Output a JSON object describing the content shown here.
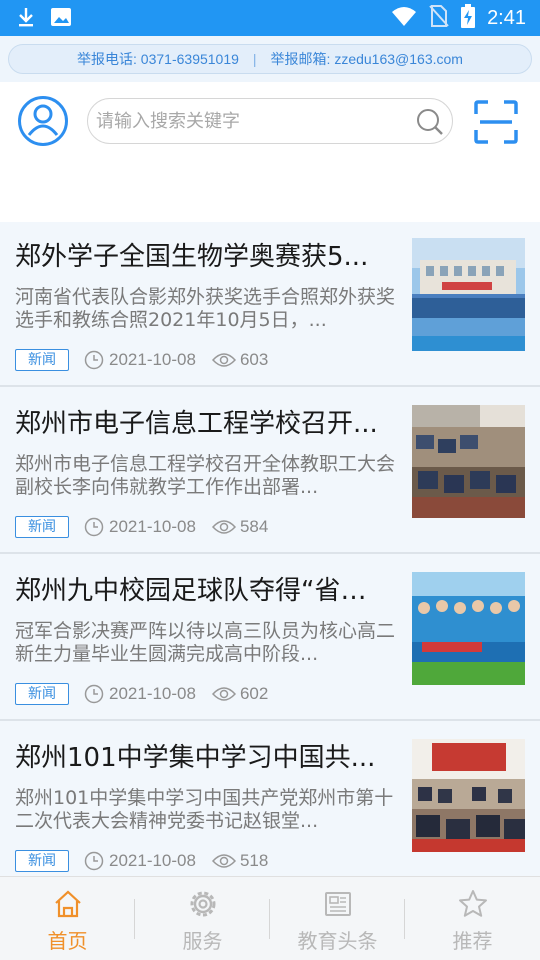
{
  "status_bar": {
    "time": "2:41",
    "icons": [
      "download-icon",
      "image-icon",
      "wifi-icon",
      "no-sim-icon",
      "battery-charging-icon"
    ]
  },
  "report": {
    "phone": "举报电话: 0371-63951019",
    "separator": "|",
    "email": "举报邮箱: zzedu163@163.com"
  },
  "header": {
    "search_placeholder": "请输入搜索关键字"
  },
  "news": [
    {
      "title": "郑外学子全国生物学奥赛获5...",
      "summary": "河南省代表队合影郑外获奖选手合照郑外获奖选手和教练合照2021年10月5日，...",
      "tag": "新闻",
      "date": "2021-10-08",
      "views": "603"
    },
    {
      "title": "郑州市电子信息工程学校召开...",
      "summary": "郑州市电子信息工程学校召开全体教职工大会副校长李向伟就教学工作作出部署...",
      "tag": "新闻",
      "date": "2021-10-08",
      "views": "584"
    },
    {
      "title": "郑州九中校园足球队夺得“省长...",
      "summary": "冠军合影决赛严阵以待以高三队员为核心高二新生力量毕业生圆满完成高中阶段...",
      "tag": "新闻",
      "date": "2021-10-08",
      "views": "602"
    },
    {
      "title": "郑州101中学集中学习中国共...",
      "summary": "郑州101中学集中学习中国共产党郑州市第十二次代表大会精神党委书记赵银堂...",
      "tag": "新闻",
      "date": "2021-10-08",
      "views": "518"
    }
  ],
  "bottom_nav": [
    {
      "label": "首页",
      "icon": "home-icon",
      "active": true
    },
    {
      "label": "服务",
      "icon": "gear-icon",
      "active": false
    },
    {
      "label": "教育头条",
      "icon": "newspaper-icon",
      "active": false
    },
    {
      "label": "推荐",
      "icon": "star-icon",
      "active": false
    }
  ],
  "colors": {
    "primary": "#2196F3",
    "accent": "#f0902a",
    "list_bg": "#f2f7fc"
  }
}
